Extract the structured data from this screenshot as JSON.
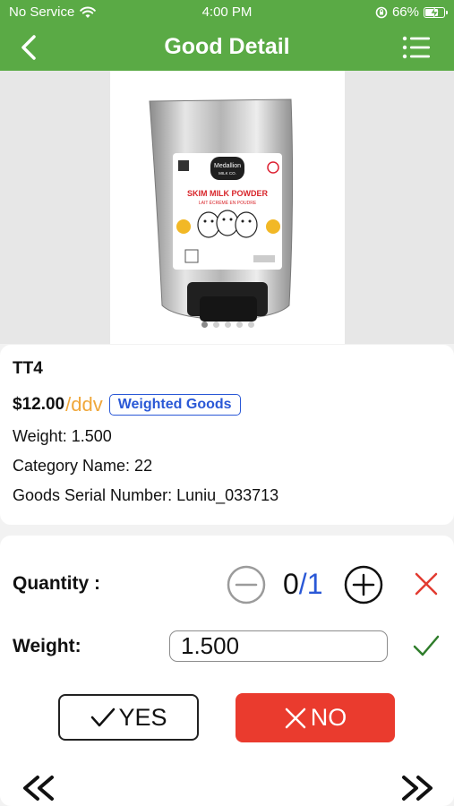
{
  "status_bar": {
    "carrier": "No Service",
    "time": "4:00 PM",
    "battery": "66%"
  },
  "nav": {
    "title": "Good Detail"
  },
  "gallery": {
    "image_count": 5,
    "active_index": 0,
    "product_image": {
      "brand": "Medallion",
      "brand_sub": "MILK CO.",
      "product": "SKIM MILK POWDER",
      "product_fr": "LAIT ÉCRÉMÉ EN POUDRE"
    }
  },
  "item": {
    "name": "TT4",
    "price": "$12.00",
    "unit": "/ddv",
    "badge": "Weighted Goods",
    "weight_line": "Weight: 1.500",
    "category_line": "Category Name: 22",
    "serial_line": "Goods Serial Number: Luniu_033713"
  },
  "actions": {
    "quantity_label": "Quantity :",
    "quantity_current": "0",
    "quantity_sep": "/",
    "quantity_total": "1",
    "weight_label": "Weight:",
    "weight_value": "1.500",
    "yes_label": "YES",
    "no_label": "NO"
  },
  "colors": {
    "header_green": "#5aaa45",
    "accent_orange": "#f0a73a",
    "badge_blue": "#2a58d6",
    "no_red": "#ea3b2e",
    "confirm_green": "#2f7d2b"
  }
}
